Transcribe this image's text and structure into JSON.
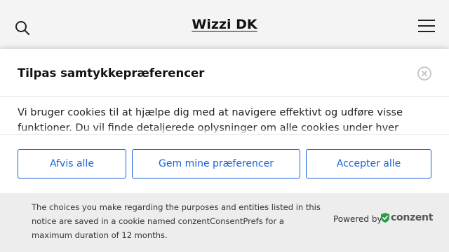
{
  "header": {
    "site_title": "Wizzi DK"
  },
  "consent": {
    "title": "Tilpas samtykkepræferencer",
    "body": "Vi bruger cookies til at hjælpe dig med at navigere effektivt og udføre visse funktioner. Du vil finde detaljerede oplysninger om alle cookies under hver",
    "buttons": {
      "reject": "Afvis alle",
      "save": "Gem mine præferencer",
      "accept": "Accepter alle"
    },
    "footer_text": "The choices you make regarding the purposes and entities listed in this notice are saved in a cookie named conzentConsentPrefs for a maximum duration of 12 months.",
    "powered_by": "Powered by",
    "logo_text": "conzent"
  },
  "colors": {
    "accent": "#1863dc",
    "logo_green": "#2e9e44"
  }
}
